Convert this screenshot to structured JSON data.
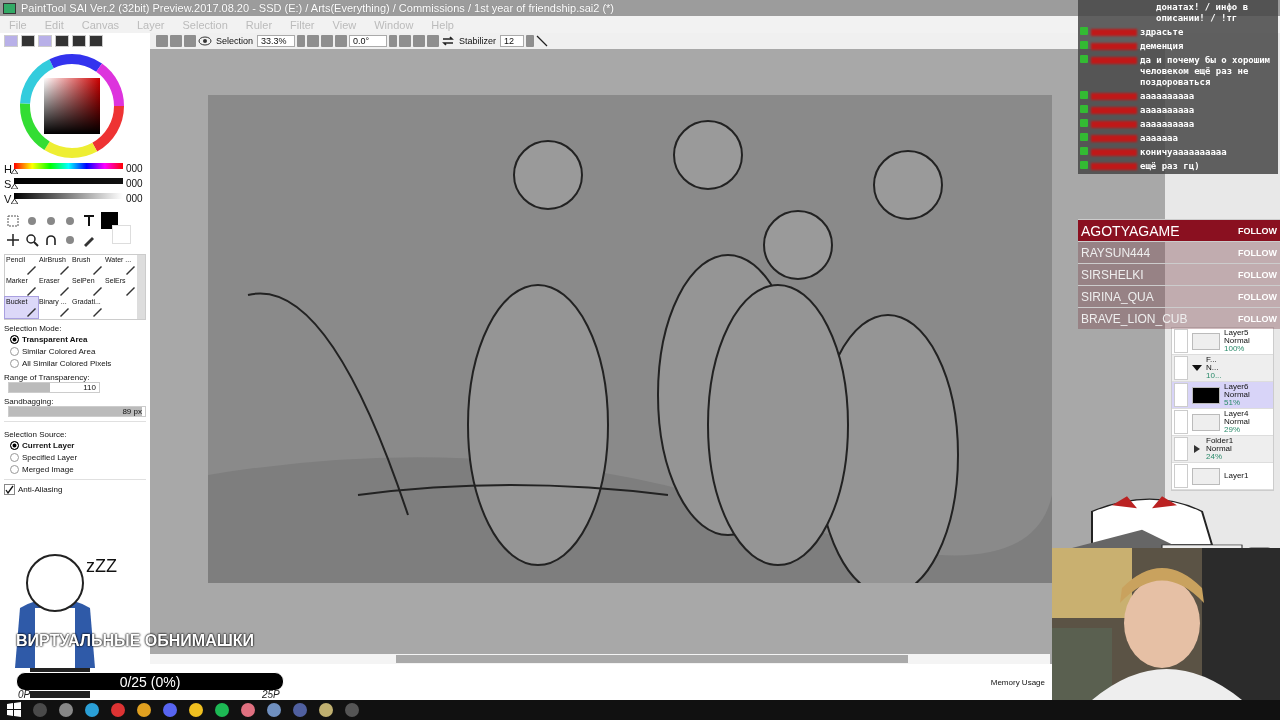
{
  "window": {
    "title": "PaintTool SAI Ver.2 (32bit) Preview.2017.08.20 - SSD (E:) / Arts(Everything) / Commissions / 1st year of friendship.sai2 (*)"
  },
  "menu": [
    "File",
    "Edit",
    "Canvas",
    "Layer",
    "Selection",
    "Ruler",
    "Filter",
    "View",
    "Window",
    "Help"
  ],
  "toolbar": {
    "view_label": "Selection",
    "zoom": "33.3%",
    "angle": "0.0°",
    "stabilizer_label": "Stabilizer",
    "stabilizer": "12"
  },
  "hsv": [
    {
      "label": "H",
      "value": "000",
      "level": 0
    },
    {
      "label": "S",
      "value": "000",
      "level": 0
    },
    {
      "label": "V",
      "value": "000",
      "level": 0
    }
  ],
  "tools": [
    {
      "label": "Pencil",
      "selected": false
    },
    {
      "label": "AirBrush",
      "selected": false
    },
    {
      "label": "Brush",
      "selected": false
    },
    {
      "label": "Water ...",
      "selected": false
    },
    {
      "label": "Marker",
      "selected": false
    },
    {
      "label": "Eraser",
      "selected": false
    },
    {
      "label": "SelPen",
      "selected": false
    },
    {
      "label": "SelErs",
      "selected": false
    },
    {
      "label": "Bucket",
      "selected": true
    },
    {
      "label": "Binary ...",
      "selected": false
    },
    {
      "label": "Gradati...",
      "selected": false
    }
  ],
  "selection_mode": {
    "title": "Selection Mode:",
    "options": [
      {
        "label": "Transparent Area",
        "selected": true
      },
      {
        "label": "Similar Colored Area",
        "selected": false
      },
      {
        "label": "All Similar Colored Pixels",
        "selected": false
      }
    ]
  },
  "range": {
    "label": "Range of Transparency:",
    "value": "110",
    "level": 0.45
  },
  "sandbagging": {
    "label": "Sandbagging:",
    "value": "89",
    "unit": "px",
    "level": 0.98
  },
  "selection_source": {
    "title": "Selection Source:",
    "options": [
      {
        "label": "Current Layer",
        "selected": true
      },
      {
        "label": "Specified Layer",
        "selected": false
      },
      {
        "label": "Merged Image",
        "selected": false
      }
    ]
  },
  "anti_aliasing": {
    "label": "Anti-Aliasing",
    "checked": true
  },
  "layers": [
    {
      "kind": "layer",
      "name": "Layer5",
      "mode": "Normal",
      "opacity": "100%",
      "selected": false
    },
    {
      "kind": "folder-open",
      "name": "F...",
      "mode": "N...",
      "opacity": "10...",
      "selected": false
    },
    {
      "kind": "layer",
      "name": "Layer6",
      "mode": "Normal",
      "opacity": "51%",
      "selected": true
    },
    {
      "kind": "layer",
      "name": "Layer4",
      "mode": "Normal",
      "opacity": "29%",
      "selected": false
    },
    {
      "kind": "folder",
      "name": "Folder1",
      "mode": "Normal",
      "opacity": "24%",
      "selected": false
    },
    {
      "kind": "layer",
      "name": "Layer1",
      "selected": false
    }
  ],
  "status_bar": {
    "text": "Memory Usage"
  },
  "chat": {
    "pinned": "донатах! / инфо в описании! / !тг",
    "messages": [
      {
        "text": "здрасьте"
      },
      {
        "text": "деменция"
      },
      {
        "text": "да и почему бы о хорошим человеком ещё раз не поздороваться"
      },
      {
        "text": "аааааааааа"
      },
      {
        "text": "аааааааааа"
      },
      {
        "text": "аааааааааа"
      },
      {
        "text": "ааааааа"
      },
      {
        "text": "коничуаааааааааа"
      },
      {
        "text": "ещё раз гц)"
      }
    ]
  },
  "follows": [
    {
      "name": "AGOTYAGAME",
      "action": "FOLLOW",
      "selected": true
    },
    {
      "name": "RAYSUN444",
      "action": "FOLLOW",
      "selected": false
    },
    {
      "name": "SIRSHELKI",
      "action": "FOLLOW",
      "selected": false
    },
    {
      "name": "SIRINA_QUA",
      "action": "FOLLOW",
      "selected": false
    },
    {
      "name": "BRAVE_LION_CUB",
      "action": "FOLLOW",
      "selected": false
    }
  ],
  "goal": {
    "sleep": "zZZ",
    "title": "ВИРТУАЛЬНЫЕ ОБНИМАШКИ",
    "progress": "0/25 (0%)",
    "level": 0,
    "start": "0Р",
    "end": "25Р"
  }
}
